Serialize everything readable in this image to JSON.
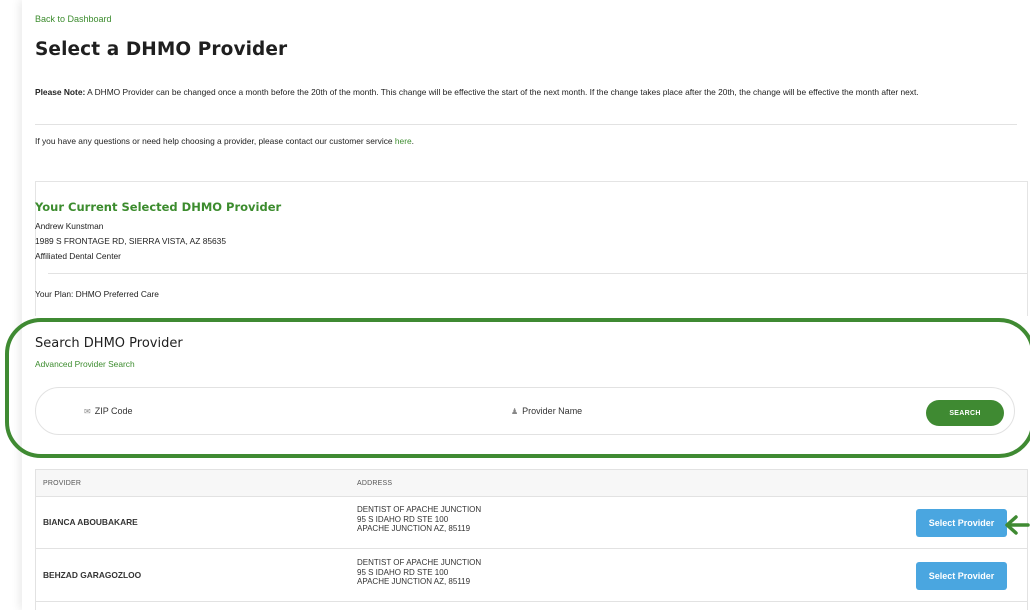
{
  "header": {
    "back_link": "Back to Dashboard",
    "title": "Select a DHMO Provider"
  },
  "note": {
    "label": "Please Note:",
    "text": " A DHMO Provider can be changed once a month before the 20th of the month. This change will be effective the start of the next month. If the change takes place after the 20th, the change will be effective the month after next."
  },
  "help": {
    "text": "If you have any questions or need help choosing a provider, please contact our customer service ",
    "link": "here",
    "suffix": "."
  },
  "current": {
    "title": "Your Current Selected DHMO Provider",
    "name": "Andrew Kunstman",
    "address": "1989 S FRONTAGE RD, SIERRA VISTA, AZ 85635",
    "group": "Affiliated Dental Center",
    "plan": "Your Plan: DHMO Preferred Care"
  },
  "search": {
    "title": "Search DHMO Provider",
    "advanced_link": "Advanced Provider Search",
    "zip_placeholder": "ZIP Code",
    "name_placeholder": "Provider Name",
    "button": "SEARCH"
  },
  "table": {
    "col_provider": "PROVIDER",
    "col_address": "ADDRESS",
    "rows": [
      {
        "provider": "BIANCA ABOUBAKARE",
        "addr1": "DENTIST OF APACHE JUNCTION",
        "addr2": "95 S IDAHO RD STE 100",
        "addr3": "APACHE JUNCTION AZ, 85119",
        "button": "Select Provider"
      },
      {
        "provider": "BEHZAD GARAGOZLOO",
        "addr1": "DENTIST OF APACHE JUNCTION",
        "addr2": "95 S IDAHO RD STE 100",
        "addr3": "APACHE JUNCTION AZ, 85119",
        "button": "Select Provider"
      }
    ]
  },
  "colors": {
    "brand_green": "#3f8a32",
    "link_green": "#3c8c2e",
    "select_blue": "#4aa6e0"
  }
}
